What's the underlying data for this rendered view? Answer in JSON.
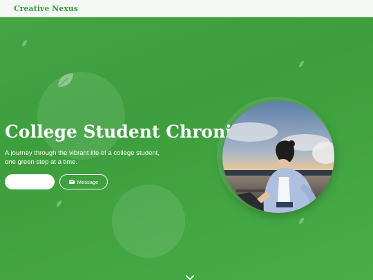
{
  "header": {
    "brand": "Creative Nexus"
  },
  "hero": {
    "title": "College Student Chronicle",
    "subtitle": "A journey through the vibrant life of a college student, one green step at a time.",
    "primary_button_label": "",
    "message_button_label": "Message",
    "photo_icon": "profile-photo"
  },
  "colors": {
    "accent": "#3a9a3a",
    "background": "#43a543",
    "header_bg": "#f5f7f5",
    "text_light": "#ffffff"
  }
}
